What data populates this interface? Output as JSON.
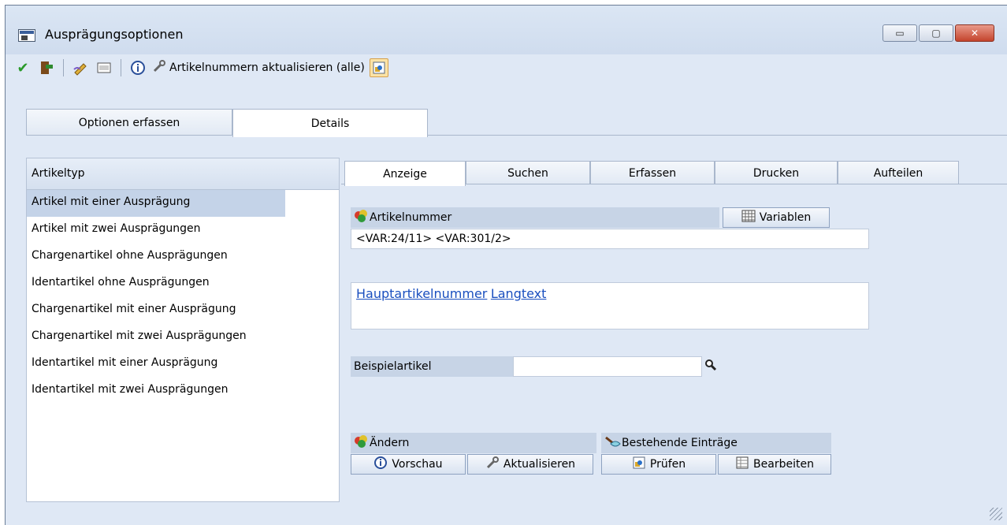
{
  "window": {
    "title": "Ausprägungsoptionen",
    "controls": {
      "minimize": "▭",
      "maximize": "▢",
      "close": "✕"
    }
  },
  "toolbar": {
    "icons": [
      "check-icon",
      "exit-icon",
      "edit-icon",
      "layout-icon",
      "info-icon"
    ],
    "update_all_label": "Artikelnummern aktualisieren (alle)"
  },
  "top_tabs": [
    {
      "label": "Optionen erfassen",
      "active": false
    },
    {
      "label": "Details",
      "active": true
    }
  ],
  "article_types": {
    "header": "Artikeltyp",
    "items": [
      "Artikel mit einer Ausprägung",
      "Artikel mit zwei Ausprägungen",
      "Chargenartikel ohne Ausprägungen",
      "Identartikel ohne Ausprägungen",
      "Chargenartikel mit einer Ausprägung",
      "Chargenartikel mit zwei Ausprägungen",
      "Identartikel mit einer Ausprägung",
      "Identartikel mit zwei Ausprägungen"
    ],
    "selected_index": 0
  },
  "sub_tabs": [
    {
      "label": "Anzeige",
      "active": true
    },
    {
      "label": "Suchen",
      "active": false
    },
    {
      "label": "Erfassen",
      "active": false
    },
    {
      "label": "Drucken",
      "active": false
    },
    {
      "label": "Aufteilen",
      "active": false
    }
  ],
  "artikelnummer": {
    "label": "Artikelnummer",
    "variables_button": "Variablen",
    "value": "<VAR:24/11> <VAR:301/2>",
    "links": [
      "Hauptartikelnummer",
      "Langtext"
    ]
  },
  "beispielartikel": {
    "label": "Beispielartikel",
    "value": ""
  },
  "aendern": {
    "label": "Ändern",
    "preview_button": "Vorschau",
    "update_button": "Aktualisieren"
  },
  "bestehende": {
    "label": "Bestehende Einträge",
    "check_button": "Prüfen",
    "edit_button": "Bearbeiten"
  },
  "colors": {
    "window_bg": "#dfe8f5",
    "selected_row": "#c4d3e8",
    "section_bar": "#c7d4e6",
    "link": "#1a4fbf"
  }
}
